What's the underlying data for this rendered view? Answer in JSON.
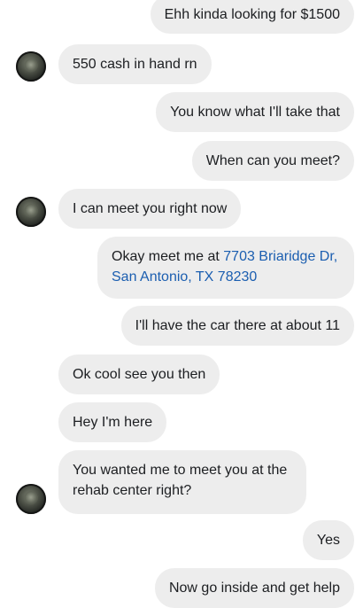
{
  "messages": [
    {
      "side": "right",
      "text": "Ehh kinda looking for $1500"
    },
    {
      "side": "left",
      "text": "550 cash in hand rn"
    },
    {
      "side": "right",
      "text": "You know what I'll take that"
    },
    {
      "side": "right",
      "text": "When can you meet?"
    },
    {
      "side": "left",
      "text": "I can meet you right now"
    },
    {
      "side": "right",
      "prefix": "Okay meet me at ",
      "link": "7703 Briaridge Dr, San Antonio, TX 78230"
    },
    {
      "side": "right",
      "text": "I'll have the car there at about 11"
    },
    {
      "side": "left",
      "text": "Ok cool see you then"
    },
    {
      "side": "left",
      "text": "Hey I'm here"
    },
    {
      "side": "left",
      "text": "You wanted me to meet you at the rehab center right?"
    },
    {
      "side": "right",
      "text": "Yes"
    },
    {
      "side": "right",
      "text": "Now go inside and get help"
    }
  ],
  "colors": {
    "bubble": "#ededed",
    "link": "#1b5eb0",
    "text": "#1c1e21"
  }
}
